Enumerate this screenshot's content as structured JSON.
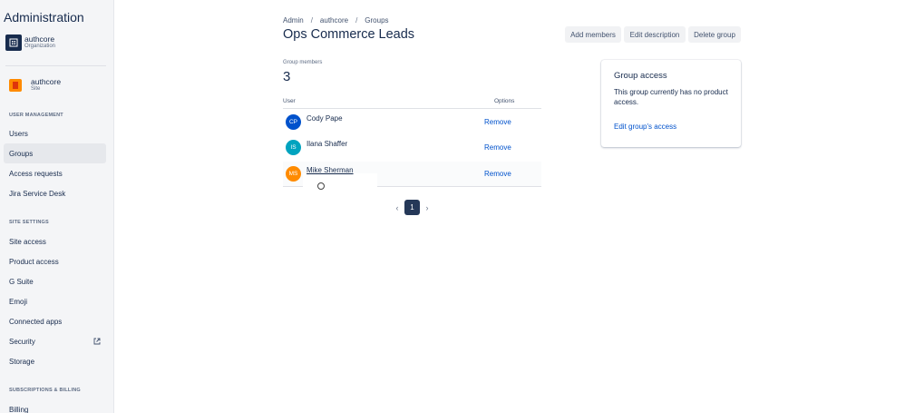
{
  "sidebar": {
    "app_title": "Administration",
    "org": {
      "name": "authcore",
      "sub": "Organization"
    },
    "site": {
      "name": "authcore",
      "sub": "Site"
    },
    "sections": {
      "user_management": "USER MANAGEMENT",
      "site_settings": "SITE SETTINGS",
      "subscriptions": "SUBSCRIPTIONS & BILLING"
    },
    "items": {
      "users": "Users",
      "groups": "Groups",
      "access_requests": "Access requests",
      "jira_service_desk": "Jira Service Desk",
      "site_access": "Site access",
      "product_access": "Product access",
      "g_suite": "G Suite",
      "emoji": "Emoji",
      "connected_apps": "Connected apps",
      "security": "Security",
      "storage": "Storage",
      "billing": "Billing"
    }
  },
  "breadcrumb": {
    "admin": "Admin",
    "site": "authcore",
    "groups": "Groups",
    "separator": "/"
  },
  "page_title": "Ops Commerce Leads",
  "actions": {
    "add_members": "Add members",
    "edit_description": "Edit description",
    "delete_group": "Delete group"
  },
  "members": {
    "label": "Group members",
    "count": "3",
    "columns": {
      "user": "User",
      "options": "Options"
    },
    "rows": [
      {
        "initials": "CP",
        "name": "Cody Pape",
        "action": "Remove",
        "color": "#0052cc"
      },
      {
        "initials": "IS",
        "name": "Ilana Shaffer",
        "action": "Remove",
        "color": "#00a3bf"
      },
      {
        "initials": "MS",
        "name": "Mike Sherman",
        "action": "Remove",
        "color": "#ff8b00"
      }
    ]
  },
  "pagination": {
    "current": "1",
    "prev_icon": "‹",
    "next_icon": "›"
  },
  "group_access": {
    "title": "Group access",
    "text": "This group currently has no product access.",
    "link": "Edit group's access"
  }
}
